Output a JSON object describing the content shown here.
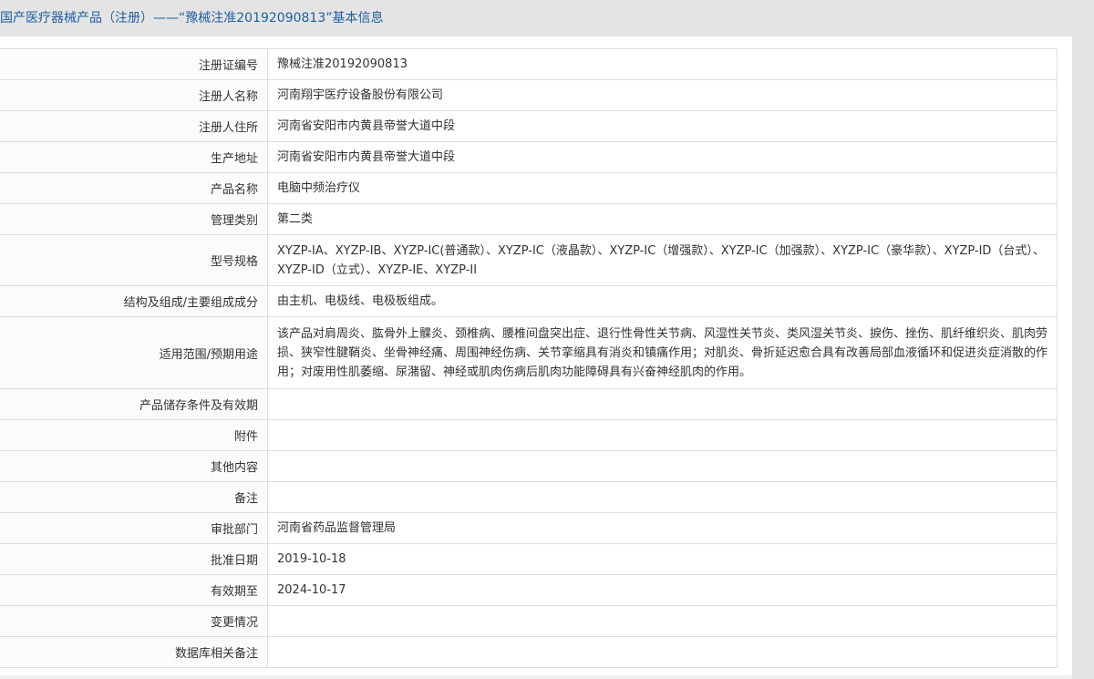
{
  "header": {
    "title": "国产医疗器械产品（注册）——“豫械注准20192090813”基本信息"
  },
  "rows": [
    {
      "label": "注册证编号",
      "value": "豫械注准20192090813"
    },
    {
      "label": "注册人名称",
      "value": "河南翔宇医疗设备股份有限公司"
    },
    {
      "label": "注册人住所",
      "value": "河南省安阳市内黄县帝誉大道中段"
    },
    {
      "label": "生产地址",
      "value": "河南省安阳市内黄县帝誉大道中段"
    },
    {
      "label": "产品名称",
      "value": "电脑中频治疗仪"
    },
    {
      "label": "管理类别",
      "value": "第二类"
    },
    {
      "label": "型号规格",
      "value": "XYZP-IA、XYZP-IB、XYZP-IC(普通款）、XYZP-IC（液晶款）、XYZP-IC（增强款）、XYZP-IC（加强款）、XYZP-IC（豪华款）、XYZP-ID（台式）、XYZP-ID（立式）、XYZP-IE、XYZP-II"
    },
    {
      "label": "结构及组成/主要组成成分",
      "value": "由主机、电极线、电极板组成。"
    },
    {
      "label": "适用范围/预期用途",
      "value": "该产品对肩周炎、肱骨外上髁炎、颈椎病、腰椎间盘突出症、退行性骨性关节病、风湿性关节炎、类风湿关节炎、捩伤、挫伤、肌纤维织炎、肌肉劳损、狭窄性腱鞘炎、坐骨神经痛、周围神经伤病、关节挛缩具有消炎和镇痛作用；对肌炎、骨折延迟愈合具有改善局部血液循环和促进炎症消散的作用；对废用性肌萎缩、尿潴留、神经或肌肉伤病后肌肉功能障碍具有兴奋神经肌肉的作用。"
    },
    {
      "label": "产品储存条件及有效期",
      "value": ""
    },
    {
      "label": "附件",
      "value": ""
    },
    {
      "label": "其他内容",
      "value": ""
    },
    {
      "label": "备注",
      "value": ""
    },
    {
      "label": "审批部门",
      "value": "河南省药品监督管理局"
    },
    {
      "label": "批准日期",
      "value": "2019-10-18"
    },
    {
      "label": "有效期至",
      "value": "2024-10-17"
    },
    {
      "label": "变更情况",
      "value": ""
    },
    {
      "label": "数据库相关备注",
      "value": ""
    }
  ]
}
